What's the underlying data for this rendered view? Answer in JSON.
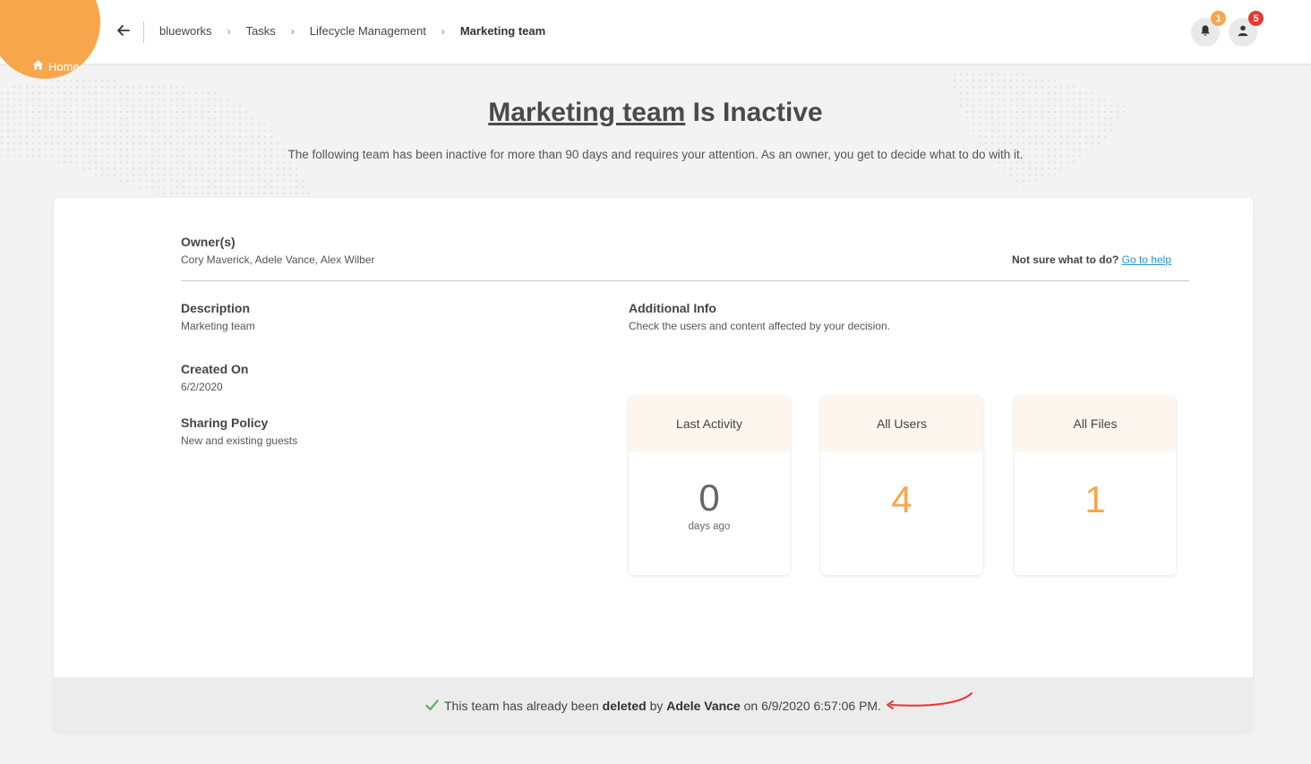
{
  "app": {
    "home_label": "Home",
    "accent_color": "#f7a64b",
    "icons": {
      "home": "home-icon",
      "back": "arrow-left-icon",
      "notifications": "bell-icon",
      "profile": "user-icon",
      "success": "checkmark-icon"
    }
  },
  "breadcrumb": {
    "items": [
      "blueworks",
      "Tasks",
      "Lifecycle Management"
    ],
    "current": "Marketing team"
  },
  "header_actions": {
    "notifications_count": "1",
    "notifications_badge_color": "#f7a64b",
    "profile_count": "5",
    "profile_badge_color": "#e53935"
  },
  "page": {
    "title_team": "Marketing team",
    "title_suffix": " Is Inactive",
    "subtitle": "The following team has been inactive for more than 90 days and requires your attention. As an owner, you get to decide what to do with it."
  },
  "details": {
    "owners_label": "Owner(s)",
    "owners_value": "Cory Maverick, Adele Vance, Alex Wilber",
    "help_prefix": "Not sure what to do?",
    "help_link": "Go to help",
    "description_label": "Description",
    "description_value": "Marketing team",
    "created_label": "Created On",
    "created_value": "6/2/2020",
    "sharing_label": "Sharing Policy",
    "sharing_value": "New and existing guests",
    "additional_label": "Additional Info",
    "additional_value": "Check the users and content affected by your decision."
  },
  "stats": [
    {
      "label": "Last Activity",
      "value": "0",
      "unit": "days ago",
      "color": "#666666"
    },
    {
      "label": "All Users",
      "value": "4",
      "unit": "",
      "color": "#f7a64b"
    },
    {
      "label": "All Files",
      "value": "1",
      "unit": "",
      "color": "#f7a64b"
    }
  ],
  "status": {
    "prefix": "This team has already been",
    "action": "deleted",
    "by_word": "by",
    "user": "Adele Vance",
    "on_word": "on",
    "timestamp": "6/9/2020 6:57:06 PM.",
    "check_color": "#5cb85c",
    "annotation_color": "#e53935"
  }
}
